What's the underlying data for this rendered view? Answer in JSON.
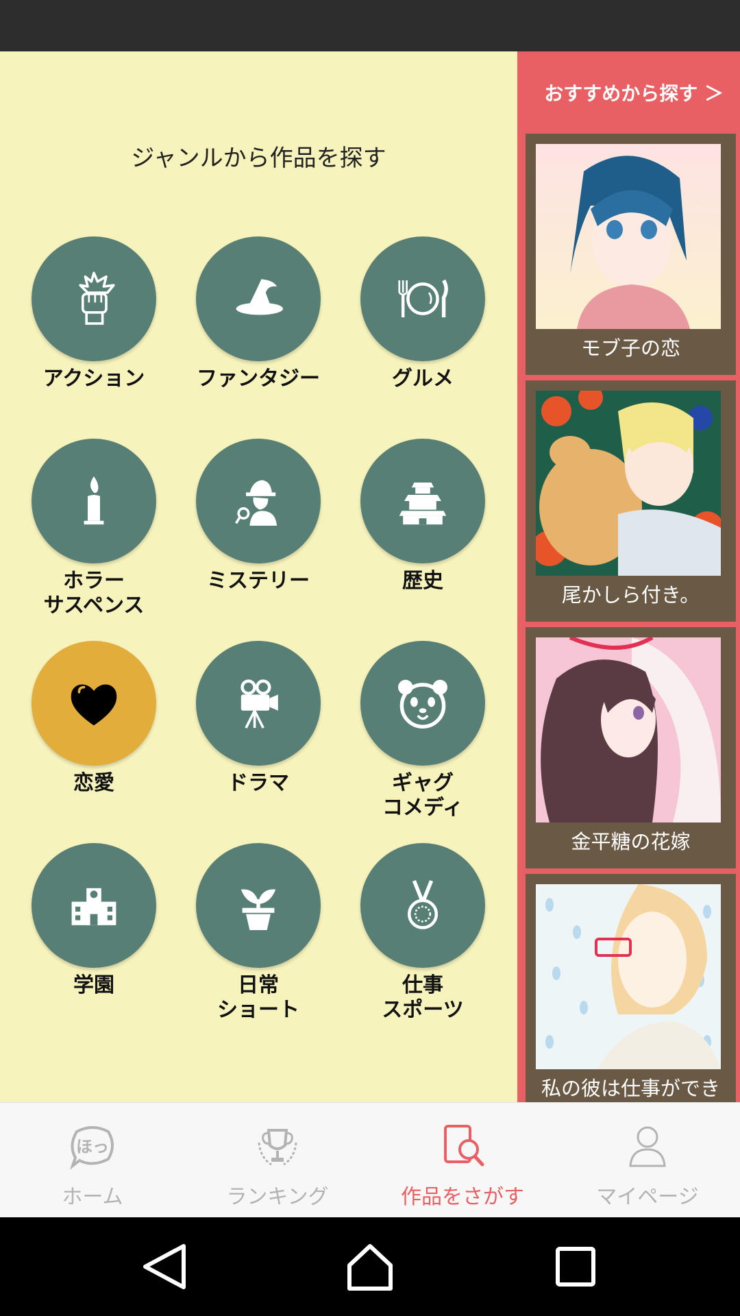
{
  "genre_section": {
    "title": "ジャンルから作品を探す",
    "genres": [
      {
        "label": "アクション",
        "icon": "fist-icon",
        "active": false
      },
      {
        "label": "ファンタジー",
        "icon": "witch-hat-icon",
        "active": false
      },
      {
        "label": "グルメ",
        "icon": "fork-plate-knife-icon",
        "active": false
      },
      {
        "label": "ホラー\nサスペンス",
        "icon": "candle-icon",
        "active": false
      },
      {
        "label": "ミステリー",
        "icon": "detective-icon",
        "active": false
      },
      {
        "label": "歴史",
        "icon": "castle-icon",
        "active": false
      },
      {
        "label": "恋愛",
        "icon": "heart-icon",
        "active": true
      },
      {
        "label": "ドラマ",
        "icon": "movie-camera-icon",
        "active": false
      },
      {
        "label": "ギャグ\nコメディ",
        "icon": "panda-icon",
        "active": false
      },
      {
        "label": "学園",
        "icon": "school-icon",
        "active": false
      },
      {
        "label": "日常\nショート",
        "icon": "sprout-icon",
        "active": false
      },
      {
        "label": "仕事\nスポーツ",
        "icon": "medal-icon",
        "active": false
      }
    ]
  },
  "recommend": {
    "link_label": "おすすめから探す ＞",
    "cards": [
      {
        "title": "モブ子の恋"
      },
      {
        "title": "尾かしら付き。"
      },
      {
        "title": "金平糖の花嫁"
      },
      {
        "title": "私の彼は仕事ができ"
      }
    ]
  },
  "bottom_nav": {
    "items": [
      {
        "label": "ホーム",
        "icon": "hotto-bubble-icon",
        "active": false
      },
      {
        "label": "ランキング",
        "icon": "trophy-icon",
        "active": false
      },
      {
        "label": "作品をさがす",
        "icon": "search-book-icon",
        "active": true
      },
      {
        "label": "マイページ",
        "icon": "person-icon",
        "active": false
      }
    ]
  },
  "colors": {
    "background": "#f7f3bc",
    "genre_circle": "#577f75",
    "genre_circle_active": "#e3ad3b",
    "side_panel": "#e85f64",
    "card_frame": "#6a5a45",
    "nav_active": "#e85f64",
    "nav_inactive": "#b3b3b3"
  }
}
